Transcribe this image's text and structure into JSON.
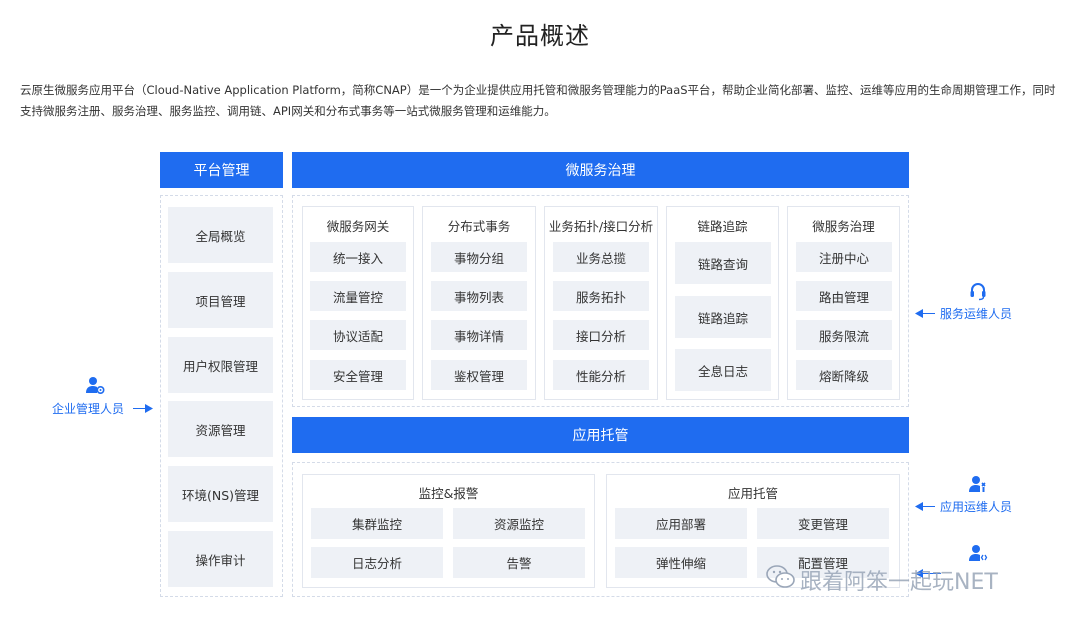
{
  "title": "产品概述",
  "intro": "云原生微服务应用平台（Cloud-Native Application Platform，简称CNAP）是一个为企业提供应用托管和微服务管理能力的PaaS平台，帮助企业简化部署、监控、运维等应用的生命周期管理工作，同时支持微服务注册、服务治理、服务监控、调用链、API网关和分布式事务等一站式微服务管理和运维能力。",
  "platform": {
    "header": "平台管理",
    "items": [
      "全局概览",
      "项目管理",
      "用户权限管理",
      "资源管理",
      "环境(NS)管理",
      "操作审计"
    ]
  },
  "microservice": {
    "header": "微服务治理",
    "columns": [
      {
        "title": "微服务网关",
        "items": [
          "统一接入",
          "流量管控",
          "协议适配",
          "安全管理"
        ]
      },
      {
        "title": "分布式事务",
        "items": [
          "事物分组",
          "事物列表",
          "事物详情",
          "鉴权管理"
        ]
      },
      {
        "title": "业务拓扑/接口分析",
        "items": [
          "业务总揽",
          "服务拓扑",
          "接口分析",
          "性能分析"
        ]
      },
      {
        "title": "链路追踪",
        "items": [
          "链路查询",
          "链路追踪",
          "全息日志"
        ]
      },
      {
        "title": "微服务治理",
        "items": [
          "注册中心",
          "路由管理",
          "服务限流",
          "熔断降级"
        ]
      }
    ]
  },
  "hosting": {
    "header": "应用托管",
    "groups": [
      {
        "title": "监控&报警",
        "items": [
          "集群监控",
          "资源监控",
          "日志分析",
          "告警"
        ]
      },
      {
        "title": "应用托管",
        "items": [
          "应用部署",
          "变更管理",
          "弹性伸缩",
          "配置管理"
        ]
      }
    ]
  },
  "roles": {
    "enterprise_admin": "企业管理人员",
    "service_ops": "服务运维人员",
    "app_ops": "应用运维人员"
  },
  "watermark": "跟着阿笨一起玩NET",
  "colors": {
    "accent": "#1f6cf0",
    "cell_bg": "#eef1f6",
    "frame": "#d4dbe8"
  }
}
